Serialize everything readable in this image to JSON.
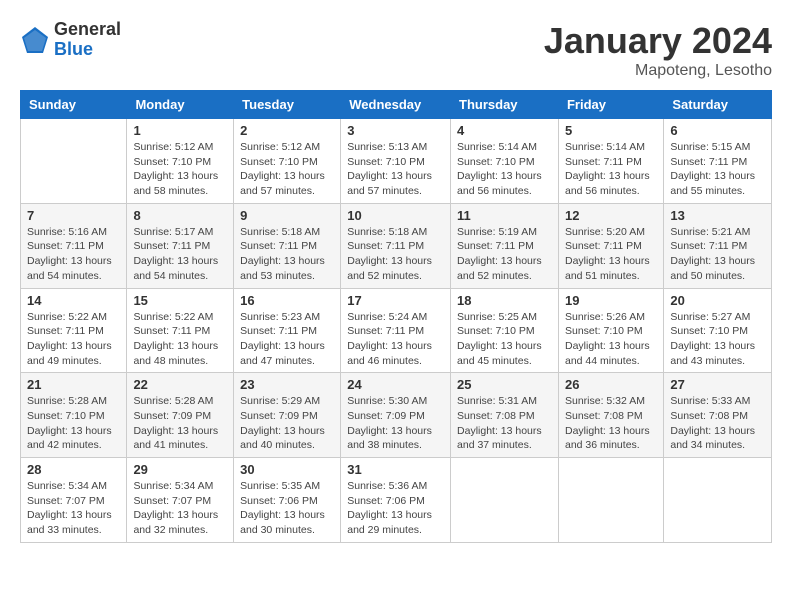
{
  "logo": {
    "general": "General",
    "blue": "Blue"
  },
  "title": {
    "month": "January 2024",
    "location": "Mapoteng, Lesotho"
  },
  "weekdays": [
    "Sunday",
    "Monday",
    "Tuesday",
    "Wednesday",
    "Thursday",
    "Friday",
    "Saturday"
  ],
  "weeks": [
    [
      {
        "day": "",
        "info": ""
      },
      {
        "day": "1",
        "info": "Sunrise: 5:12 AM\nSunset: 7:10 PM\nDaylight: 13 hours\nand 58 minutes."
      },
      {
        "day": "2",
        "info": "Sunrise: 5:12 AM\nSunset: 7:10 PM\nDaylight: 13 hours\nand 57 minutes."
      },
      {
        "day": "3",
        "info": "Sunrise: 5:13 AM\nSunset: 7:10 PM\nDaylight: 13 hours\nand 57 minutes."
      },
      {
        "day": "4",
        "info": "Sunrise: 5:14 AM\nSunset: 7:10 PM\nDaylight: 13 hours\nand 56 minutes."
      },
      {
        "day": "5",
        "info": "Sunrise: 5:14 AM\nSunset: 7:11 PM\nDaylight: 13 hours\nand 56 minutes."
      },
      {
        "day": "6",
        "info": "Sunrise: 5:15 AM\nSunset: 7:11 PM\nDaylight: 13 hours\nand 55 minutes."
      }
    ],
    [
      {
        "day": "7",
        "info": "Sunrise: 5:16 AM\nSunset: 7:11 PM\nDaylight: 13 hours\nand 54 minutes."
      },
      {
        "day": "8",
        "info": "Sunrise: 5:17 AM\nSunset: 7:11 PM\nDaylight: 13 hours\nand 54 minutes."
      },
      {
        "day": "9",
        "info": "Sunrise: 5:18 AM\nSunset: 7:11 PM\nDaylight: 13 hours\nand 53 minutes."
      },
      {
        "day": "10",
        "info": "Sunrise: 5:18 AM\nSunset: 7:11 PM\nDaylight: 13 hours\nand 52 minutes."
      },
      {
        "day": "11",
        "info": "Sunrise: 5:19 AM\nSunset: 7:11 PM\nDaylight: 13 hours\nand 52 minutes."
      },
      {
        "day": "12",
        "info": "Sunrise: 5:20 AM\nSunset: 7:11 PM\nDaylight: 13 hours\nand 51 minutes."
      },
      {
        "day": "13",
        "info": "Sunrise: 5:21 AM\nSunset: 7:11 PM\nDaylight: 13 hours\nand 50 minutes."
      }
    ],
    [
      {
        "day": "14",
        "info": "Sunrise: 5:22 AM\nSunset: 7:11 PM\nDaylight: 13 hours\nand 49 minutes."
      },
      {
        "day": "15",
        "info": "Sunrise: 5:22 AM\nSunset: 7:11 PM\nDaylight: 13 hours\nand 48 minutes."
      },
      {
        "day": "16",
        "info": "Sunrise: 5:23 AM\nSunset: 7:11 PM\nDaylight: 13 hours\nand 47 minutes."
      },
      {
        "day": "17",
        "info": "Sunrise: 5:24 AM\nSunset: 7:11 PM\nDaylight: 13 hours\nand 46 minutes."
      },
      {
        "day": "18",
        "info": "Sunrise: 5:25 AM\nSunset: 7:10 PM\nDaylight: 13 hours\nand 45 minutes."
      },
      {
        "day": "19",
        "info": "Sunrise: 5:26 AM\nSunset: 7:10 PM\nDaylight: 13 hours\nand 44 minutes."
      },
      {
        "day": "20",
        "info": "Sunrise: 5:27 AM\nSunset: 7:10 PM\nDaylight: 13 hours\nand 43 minutes."
      }
    ],
    [
      {
        "day": "21",
        "info": "Sunrise: 5:28 AM\nSunset: 7:10 PM\nDaylight: 13 hours\nand 42 minutes."
      },
      {
        "day": "22",
        "info": "Sunrise: 5:28 AM\nSunset: 7:09 PM\nDaylight: 13 hours\nand 41 minutes."
      },
      {
        "day": "23",
        "info": "Sunrise: 5:29 AM\nSunset: 7:09 PM\nDaylight: 13 hours\nand 40 minutes."
      },
      {
        "day": "24",
        "info": "Sunrise: 5:30 AM\nSunset: 7:09 PM\nDaylight: 13 hours\nand 38 minutes."
      },
      {
        "day": "25",
        "info": "Sunrise: 5:31 AM\nSunset: 7:08 PM\nDaylight: 13 hours\nand 37 minutes."
      },
      {
        "day": "26",
        "info": "Sunrise: 5:32 AM\nSunset: 7:08 PM\nDaylight: 13 hours\nand 36 minutes."
      },
      {
        "day": "27",
        "info": "Sunrise: 5:33 AM\nSunset: 7:08 PM\nDaylight: 13 hours\nand 34 minutes."
      }
    ],
    [
      {
        "day": "28",
        "info": "Sunrise: 5:34 AM\nSunset: 7:07 PM\nDaylight: 13 hours\nand 33 minutes."
      },
      {
        "day": "29",
        "info": "Sunrise: 5:34 AM\nSunset: 7:07 PM\nDaylight: 13 hours\nand 32 minutes."
      },
      {
        "day": "30",
        "info": "Sunrise: 5:35 AM\nSunset: 7:06 PM\nDaylight: 13 hours\nand 30 minutes."
      },
      {
        "day": "31",
        "info": "Sunrise: 5:36 AM\nSunset: 7:06 PM\nDaylight: 13 hours\nand 29 minutes."
      },
      {
        "day": "",
        "info": ""
      },
      {
        "day": "",
        "info": ""
      },
      {
        "day": "",
        "info": ""
      }
    ]
  ]
}
